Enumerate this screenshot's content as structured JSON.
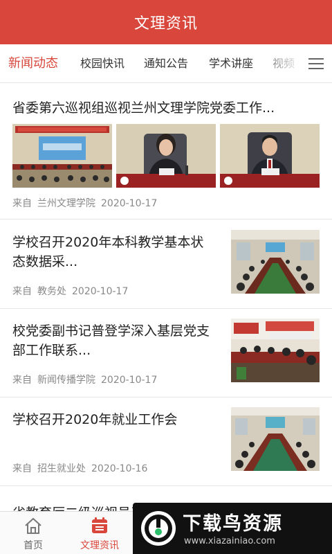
{
  "header": {
    "title": "文理资讯"
  },
  "tabs": [
    {
      "label": "新闻动态",
      "active": true
    },
    {
      "label": "校园快讯"
    },
    {
      "label": "通知公告"
    },
    {
      "label": "学术讲座"
    },
    {
      "label": "视频"
    }
  ],
  "menu_icon": "hamburger-menu-icon",
  "feed": [
    {
      "title": "省委第六巡视组巡视兰州文理学院党委工作...",
      "source_prefix": "来自",
      "source": "兰州文理学院",
      "date": "2020-10-17",
      "images": [
        "meeting-hall-photo",
        "speaker-woman-photo",
        "speaker-man-photo"
      ]
    },
    {
      "title": "学校召开2020年本科教学基本状态数据采...",
      "source_prefix": "来自",
      "source": "教务处",
      "date": "2020-10-17",
      "image": "conference-room-photo"
    },
    {
      "title": "校党委副书记普登学深入基层党支部工作联系...",
      "source_prefix": "来自",
      "source": "新闻传播学院",
      "date": "2020-10-17",
      "image": "branch-meeting-photo"
    },
    {
      "title": "学校召开2020年就业工作会",
      "source_prefix": "来自",
      "source": "招生就业处",
      "date": "2020-10-16",
      "image": "employment-meeting-photo"
    },
    {
      "title": "省教育厅二级巡视员王校一行来校检查督导"
    }
  ],
  "tabbar": [
    {
      "label": "首页",
      "icon": "home-icon"
    },
    {
      "label": "文理资讯",
      "icon": "calendar-icon",
      "active": true
    }
  ],
  "watermark": {
    "name": "下载鸟资源",
    "url": "www.xiazainiao.com"
  },
  "colors": {
    "brand": "#d9473c",
    "text": "#222222",
    "meta": "#888888"
  }
}
